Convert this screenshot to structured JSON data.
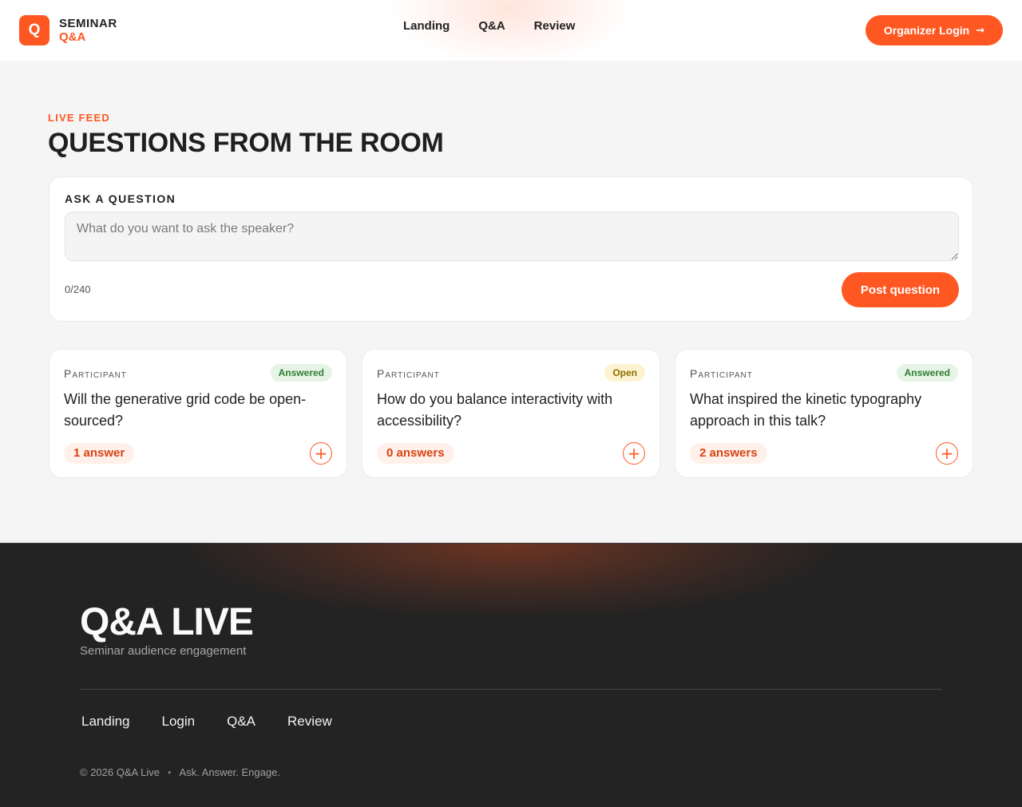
{
  "header": {
    "logo_mark": "Q",
    "logo_line1": "SEMINAR",
    "logo_line2": "Q&A",
    "nav": [
      "Landing",
      "Q&A",
      "Review"
    ],
    "login_label": "Organizer Login",
    "login_arrow": "→"
  },
  "main": {
    "eyebrow": "LIVE FEED",
    "title": "QUESTIONS FROM THE ROOM",
    "ask": {
      "label": "ASK A QUESTION",
      "placeholder": "What do you want to ask the speaker?",
      "value": "",
      "char_count": "0/240",
      "post_label": "Post question"
    },
    "questions": [
      {
        "role": "Participant",
        "status": "Answered",
        "text": "Will the generative grid code be open-sourced?",
        "answers": "1 answer",
        "add": "+"
      },
      {
        "role": "Participant",
        "status": "Open",
        "text": "How do you balance interactivity with accessibility?",
        "answers": "0 answers",
        "add": "+"
      },
      {
        "role": "Participant",
        "status": "Answered",
        "text": "What inspired the kinetic typography approach in this talk?",
        "answers": "2 answers",
        "add": "+"
      }
    ]
  },
  "footer": {
    "title": "Q&A LIVE",
    "subtitle": "Seminar audience engagement",
    "nav": [
      "Landing",
      "Login",
      "Q&A",
      "Review"
    ],
    "copyright": "© 2026 Q&A Live",
    "separator": "•",
    "tagline": "Ask. Answer. Engage."
  },
  "colors": {
    "accent": "#ff5722",
    "footer_bg": "#232323",
    "answered_badge": "#2e7d32",
    "open_badge": "#8d6e00"
  }
}
